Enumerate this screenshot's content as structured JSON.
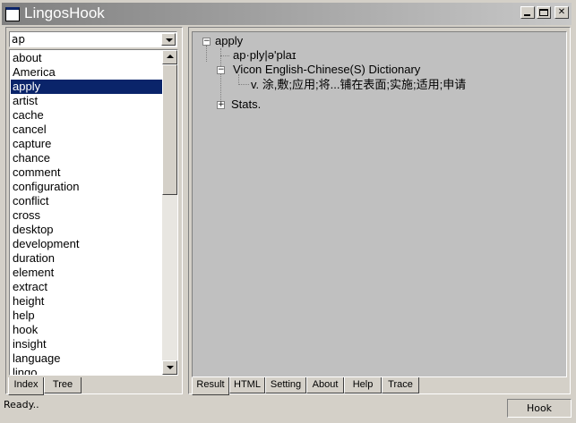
{
  "window": {
    "title": "LingosHook",
    "controls": [
      "minimize-icon",
      "maximize-icon",
      "close-icon"
    ],
    "close_glyph": "✕"
  },
  "search": {
    "value": "ap"
  },
  "word_list": {
    "selected": "apply",
    "items": [
      "about",
      "America",
      "apply",
      "artist",
      "cache",
      "cancel",
      "capture",
      "chance",
      "comment",
      "configuration",
      "conflict",
      "cross",
      "desktop",
      "development",
      "duration",
      "element",
      "extract",
      "height",
      "help",
      "hook",
      "insight",
      "language",
      "lingo"
    ]
  },
  "left_tabs": [
    "Index",
    "Tree"
  ],
  "result_tree": {
    "root": {
      "expander": "−",
      "label": "apply"
    },
    "pronunciation": "ap·ply|ə'plaɪ",
    "dictionary": {
      "expander": "−",
      "label": "Vicon English-Chinese(S) Dictionary"
    },
    "definition": "v. 涂,敷;应用;将...铺在表面;实施;适用;申请",
    "stats": {
      "expander": "+",
      "label": "Stats."
    }
  },
  "right_tabs": [
    "Result",
    "HTML",
    "Setting",
    "About",
    "Help",
    "Trace"
  ],
  "status": {
    "text": "Ready..",
    "hook_label": "Hook"
  },
  "colors": {
    "selection": "#0a246a",
    "face": "#d4d0c8",
    "result_bg": "#c0c0c0"
  }
}
